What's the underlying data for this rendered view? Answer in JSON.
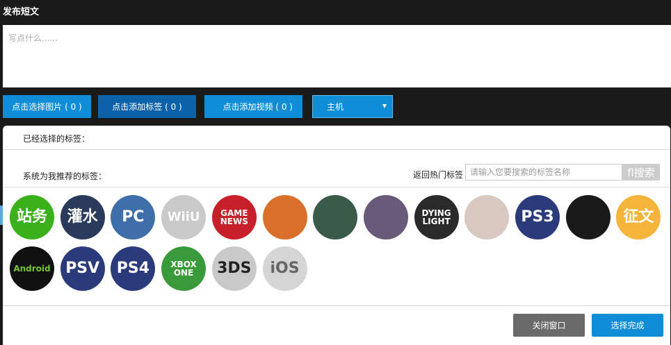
{
  "header": {
    "title": "发布短文"
  },
  "compose": {
    "placeholder": "写点什么......"
  },
  "toolbar": {
    "pick_image": "点击选择图片 ( 0 )",
    "add_tag": "点击添加标签 ( 0 )",
    "add_video": "点击添加视频 ( 0 )",
    "category_select": "主机"
  },
  "tag_panel": {
    "selected_label": "已经选择的标签：",
    "recommended_label": "系统为我推荐的标签：",
    "hot_link": "返回热门标签",
    "search_placeholder": "请输入您要搜索的标签名称",
    "search_button": "fl搜索",
    "tags": [
      {
        "text": "站务",
        "bg": "#3ab01a",
        "fg": "#ffffff",
        "icon": "tag-zhanwu"
      },
      {
        "text": "灌水",
        "bg": "#2a3a5a",
        "fg": "#ffffff",
        "icon": "tag-guanshui"
      },
      {
        "text": "PC",
        "bg": "#3f6fa8",
        "fg": "#ffffff",
        "icon": "tag-pc"
      },
      {
        "text": "WiiU",
        "bg": "#c9c9c9",
        "fg": "#ffffff",
        "icon": "tag-wiiu"
      },
      {
        "text": "GAME NEWS",
        "bg": "#c8202a",
        "fg": "#ffffff",
        "icon": "tag-game-news"
      },
      {
        "text": "",
        "bg": "#d9702a",
        "fg": "#ffffff",
        "icon": "tag-dragon-art"
      },
      {
        "text": "",
        "bg": "#3a5a4a",
        "fg": "#ffffff",
        "icon": "tag-game-art-1"
      },
      {
        "text": "",
        "bg": "#6a5a7a",
        "fg": "#ffffff",
        "icon": "tag-legend-of-legacy"
      },
      {
        "text": "DYING LIGHT",
        "bg": "#2a2a2a",
        "fg": "#ffffff",
        "icon": "tag-dying-light"
      },
      {
        "text": "",
        "bg": "#d8c8c0",
        "fg": "#ffffff",
        "icon": "tag-anime-art"
      },
      {
        "text": "PS3",
        "bg": "#2b3a7a",
        "fg": "#ffffff",
        "icon": "tag-ps3"
      },
      {
        "text": "",
        "bg": "#1a1a1a",
        "fg": "#ffffff",
        "icon": "tag-ps4-controller"
      },
      {
        "text": "征文",
        "bg": "#f5b53a",
        "fg": "#ffffff",
        "icon": "tag-zhengwen"
      },
      {
        "text": "Android",
        "bg": "#111111",
        "fg": "#7bc230",
        "icon": "tag-android"
      },
      {
        "text": "PSV",
        "bg": "#2b3a7a",
        "fg": "#ffffff",
        "icon": "tag-psv"
      },
      {
        "text": "PS4",
        "bg": "#2b3a7a",
        "fg": "#ffffff",
        "icon": "tag-ps4"
      },
      {
        "text": "XBOX ONE",
        "bg": "#3a9a3a",
        "fg": "#ffffff",
        "icon": "tag-xbox-one"
      },
      {
        "text": "3DS",
        "bg": "#c9c9c9",
        "fg": "#222222",
        "icon": "tag-3ds"
      },
      {
        "text": "iOS",
        "bg": "#d5d5d5",
        "fg": "#666666",
        "icon": "tag-ios"
      }
    ],
    "close_button": "关闭窗口",
    "done_button": "选择完成"
  }
}
